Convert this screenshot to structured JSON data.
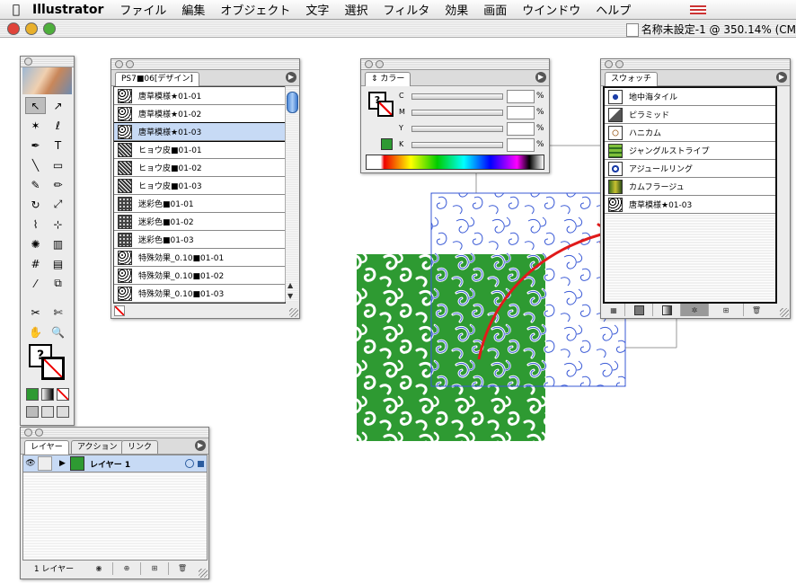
{
  "menubar": {
    "app_name": "Illustrator",
    "items": [
      "ファイル",
      "編集",
      "オブジェクト",
      "文字",
      "選択",
      "フィルタ",
      "効果",
      "画面",
      "ウインドウ",
      "ヘルプ"
    ]
  },
  "document": {
    "title": "名称未設定-1 @ 350.14% (CM"
  },
  "swatch_library": {
    "tab": "PS7■06[デザイン]",
    "items": [
      {
        "label": "唐草模様★01-01",
        "selected": false
      },
      {
        "label": "唐草模様★01-02",
        "selected": false
      },
      {
        "label": "唐草模様★01-03",
        "selected": true
      },
      {
        "label": "ヒョウ皮■01-01",
        "selected": false
      },
      {
        "label": "ヒョウ皮■01-02",
        "selected": false
      },
      {
        "label": "ヒョウ皮■01-03",
        "selected": false
      },
      {
        "label": "迷彩色■01-01",
        "selected": false
      },
      {
        "label": "迷彩色■01-02",
        "selected": false
      },
      {
        "label": "迷彩色■01-03",
        "selected": false
      },
      {
        "label": "特殊効果_0.10■01-01",
        "selected": false
      },
      {
        "label": "特殊効果_0.10■01-02",
        "selected": false
      },
      {
        "label": "特殊効果_0.10■01-03",
        "selected": false
      }
    ]
  },
  "color_panel": {
    "tab": "カラー",
    "channels": [
      {
        "label": "C",
        "value": "",
        "unit": "%"
      },
      {
        "label": "M",
        "value": "",
        "unit": "%"
      },
      {
        "label": "Y",
        "value": "",
        "unit": "%"
      },
      {
        "label": "K",
        "value": "",
        "unit": "%"
      }
    ],
    "fill_color": "#2e9a32"
  },
  "swatches_panel": {
    "tab": "スウォッチ",
    "items": [
      {
        "label": "地中海タイル",
        "icon": "tile-swatch-icon"
      },
      {
        "label": "ピラミッド",
        "icon": "pyramid-swatch-icon"
      },
      {
        "label": "ハニカム",
        "icon": "honeycomb-swatch-icon"
      },
      {
        "label": "ジャングルストライプ",
        "icon": "stripe-swatch-icon"
      },
      {
        "label": "アジュールリング",
        "icon": "ring-swatch-icon"
      },
      {
        "label": "カムフラージュ",
        "icon": "camouflage-swatch-icon"
      },
      {
        "label": "唐草模様★01-03",
        "icon": "arabesque-swatch-icon"
      }
    ]
  },
  "layers_panel": {
    "tabs": [
      "レイヤー",
      "アクション",
      "リンク"
    ],
    "layer_name": "レイヤー 1",
    "footer_count": "1 レイヤー"
  },
  "canvas": {
    "pattern_fill": "#2e9a32",
    "pattern_outline": "#3a5ad6",
    "arrow_color": "#e01a1a"
  },
  "tools": [
    "selection-tool",
    "direct-selection-tool",
    "magic-wand-tool",
    "lasso-tool",
    "pen-tool",
    "type-tool",
    "line-tool",
    "rectangle-tool",
    "paintbrush-tool",
    "pencil-tool",
    "rotate-tool",
    "scale-tool",
    "warp-tool",
    "free-transform-tool",
    "symbol-sprayer-tool",
    "graph-tool",
    "mesh-tool",
    "gradient-tool",
    "eyedropper-tool",
    "blend-tool",
    "slice-tool",
    "scissors-tool",
    "hand-tool",
    "zoom-tool"
  ]
}
